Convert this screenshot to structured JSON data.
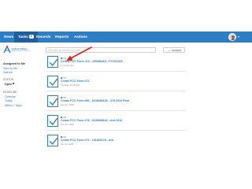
{
  "nav": {
    "items": [
      {
        "label": "News"
      },
      {
        "label": "Tasks",
        "count": "6"
      },
      {
        "label": "Records"
      },
      {
        "label": "Reports"
      },
      {
        "label": "Actions"
      }
    ],
    "accent": "#2e7ec4"
  },
  "logo": {
    "line1": "Federal Relays",
    "line2": "Administrative Services"
  },
  "sidebar": {
    "heading": "Assigned to Me",
    "links": [
      "Sent by Me",
      "Starred"
    ],
    "status_label": "STATUS",
    "status_value": "Open",
    "deadline_label": "DEADLINE",
    "deadline_items": [
      "Overdue",
      "Today",
      "Within 7 days"
    ]
  },
  "search": {
    "placeholder": "Find task by keyword or label"
  },
  "sort": {
    "label": "NEWEST"
  },
  "tasks": [
    {
      "tag": "NAI",
      "title": "Certify FCC Form 470 - 190988464 - FY2019/20",
      "date": "1 minute ago"
    },
    {
      "tag": "NAI",
      "title": "Create FCC Form 471",
      "date": "Tuesday, 12:05 AM"
    },
    {
      "tag": "NAI",
      "title": "Create FCC Form 486 - 8198688182 - 478 2019 Final",
      "date": "Nov 22, 2018"
    },
    {
      "tag": "NAI",
      "title": "Create FCC Form 478 - 8198688182 - test 2019",
      "date": "Nov 21, 2018"
    },
    {
      "tag": "NAI",
      "title": "Create FCC Form 471 - 181865178 - test",
      "date": "Oct 31, 2018"
    }
  ]
}
